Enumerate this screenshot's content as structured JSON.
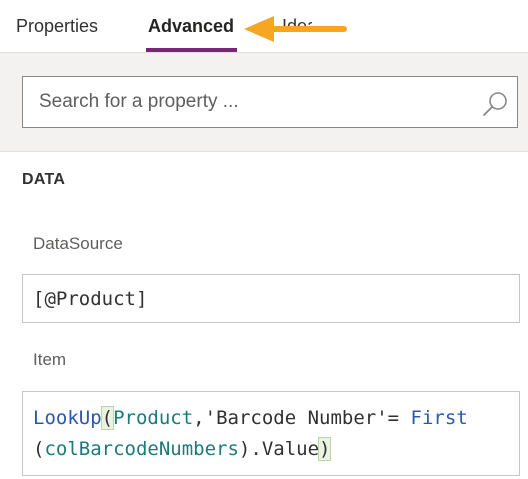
{
  "tabs": [
    {
      "label": "Properties",
      "active": false
    },
    {
      "label": "Advanced",
      "active": true
    },
    {
      "label": "Ideas",
      "active": false
    }
  ],
  "accent_color": "#742774",
  "arrow_color": "#f5a623",
  "search": {
    "placeholder": "Search for a property ...",
    "value": ""
  },
  "section": {
    "title": "DATA"
  },
  "properties": {
    "datasource": {
      "label": "DataSource",
      "formula": "[@Product]"
    },
    "item": {
      "label": "Item",
      "line1": {
        "fn": "LookUp",
        "open": "(",
        "table": "Product",
        "sep": ",",
        "str": "'Barcode Number'",
        "eq": "= ",
        "fn2": "First"
      },
      "line2": {
        "open": "(",
        "table": "colBarcodeNumbers",
        "close1": ")",
        "field": ".Value",
        "close2": ")"
      }
    }
  }
}
